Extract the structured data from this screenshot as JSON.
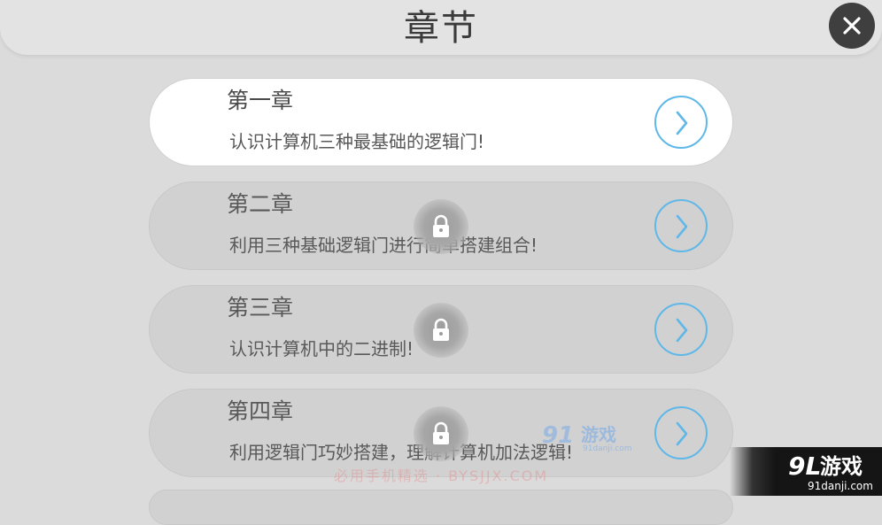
{
  "header": {
    "title": "章节"
  },
  "close_button": {
    "icon": "close-icon"
  },
  "chapters": [
    {
      "title": "第一章",
      "description": "认识计算机三种最基础的逻辑门!",
      "locked": false
    },
    {
      "title": "第二章",
      "description": "利用三种基础逻辑门进行简单搭建组合!",
      "locked": true
    },
    {
      "title": "第三章",
      "description": "认识计算机中的二进制!",
      "locked": true
    },
    {
      "title": "第四章",
      "description": "利用逻辑门巧妙搭建，理解计算机加法逻辑!",
      "locked": true
    }
  ],
  "watermarks": {
    "center_logo_number": "91",
    "center_logo_text": "游戏",
    "center_domain": "91danji.com",
    "corner_logo_number": "9L",
    "corner_logo_text": "游戏",
    "corner_domain": "91danji.com",
    "bottom_text": "必用手机精选 · BYSJJX.COM"
  },
  "colors": {
    "background": "#dcdbdb",
    "card_unlocked": "#ffffff",
    "card_locked": "#d2d1d1",
    "arrow_accent": "#5fb8e8",
    "close_button": "#3f3f3f"
  }
}
